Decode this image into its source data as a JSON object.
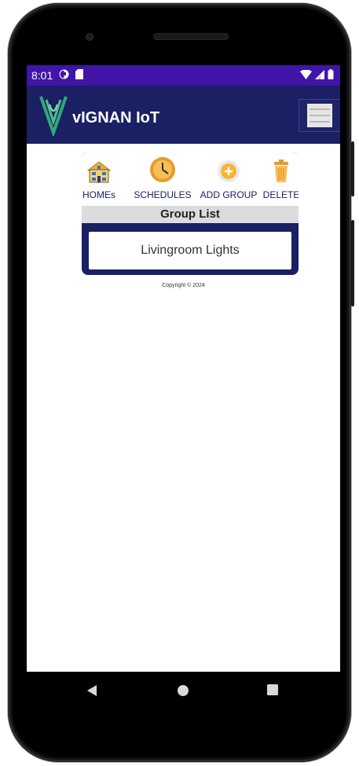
{
  "status_bar": {
    "time": "8:01",
    "icons_left": [
      "pocket-icon",
      "sd-card-icon"
    ],
    "icons_right": [
      "wifi-icon",
      "signal-icon",
      "battery-icon"
    ]
  },
  "app_bar": {
    "title": "vIGNAN IoT",
    "logo": "vignan-logo-icon",
    "menu_icon": "hamburger-menu-icon"
  },
  "toolbar": {
    "items": [
      {
        "label": "HOMEs",
        "icon": "home-icon"
      },
      {
        "label": "SCHEDULES",
        "icon": "clock-icon"
      },
      {
        "label": "ADD GROUP",
        "icon": "add-circle-icon"
      },
      {
        "label": "DELETE",
        "icon": "trash-icon"
      }
    ]
  },
  "group_list": {
    "header": "Group List",
    "items": [
      "Livingroom Lights"
    ]
  },
  "footer": {
    "copyright": "Copyright © 2024"
  },
  "colors": {
    "status_bar": "#4015a8",
    "app_bar": "#1a2063",
    "card": "#1a2063",
    "header_bg": "#dcdcdc"
  }
}
